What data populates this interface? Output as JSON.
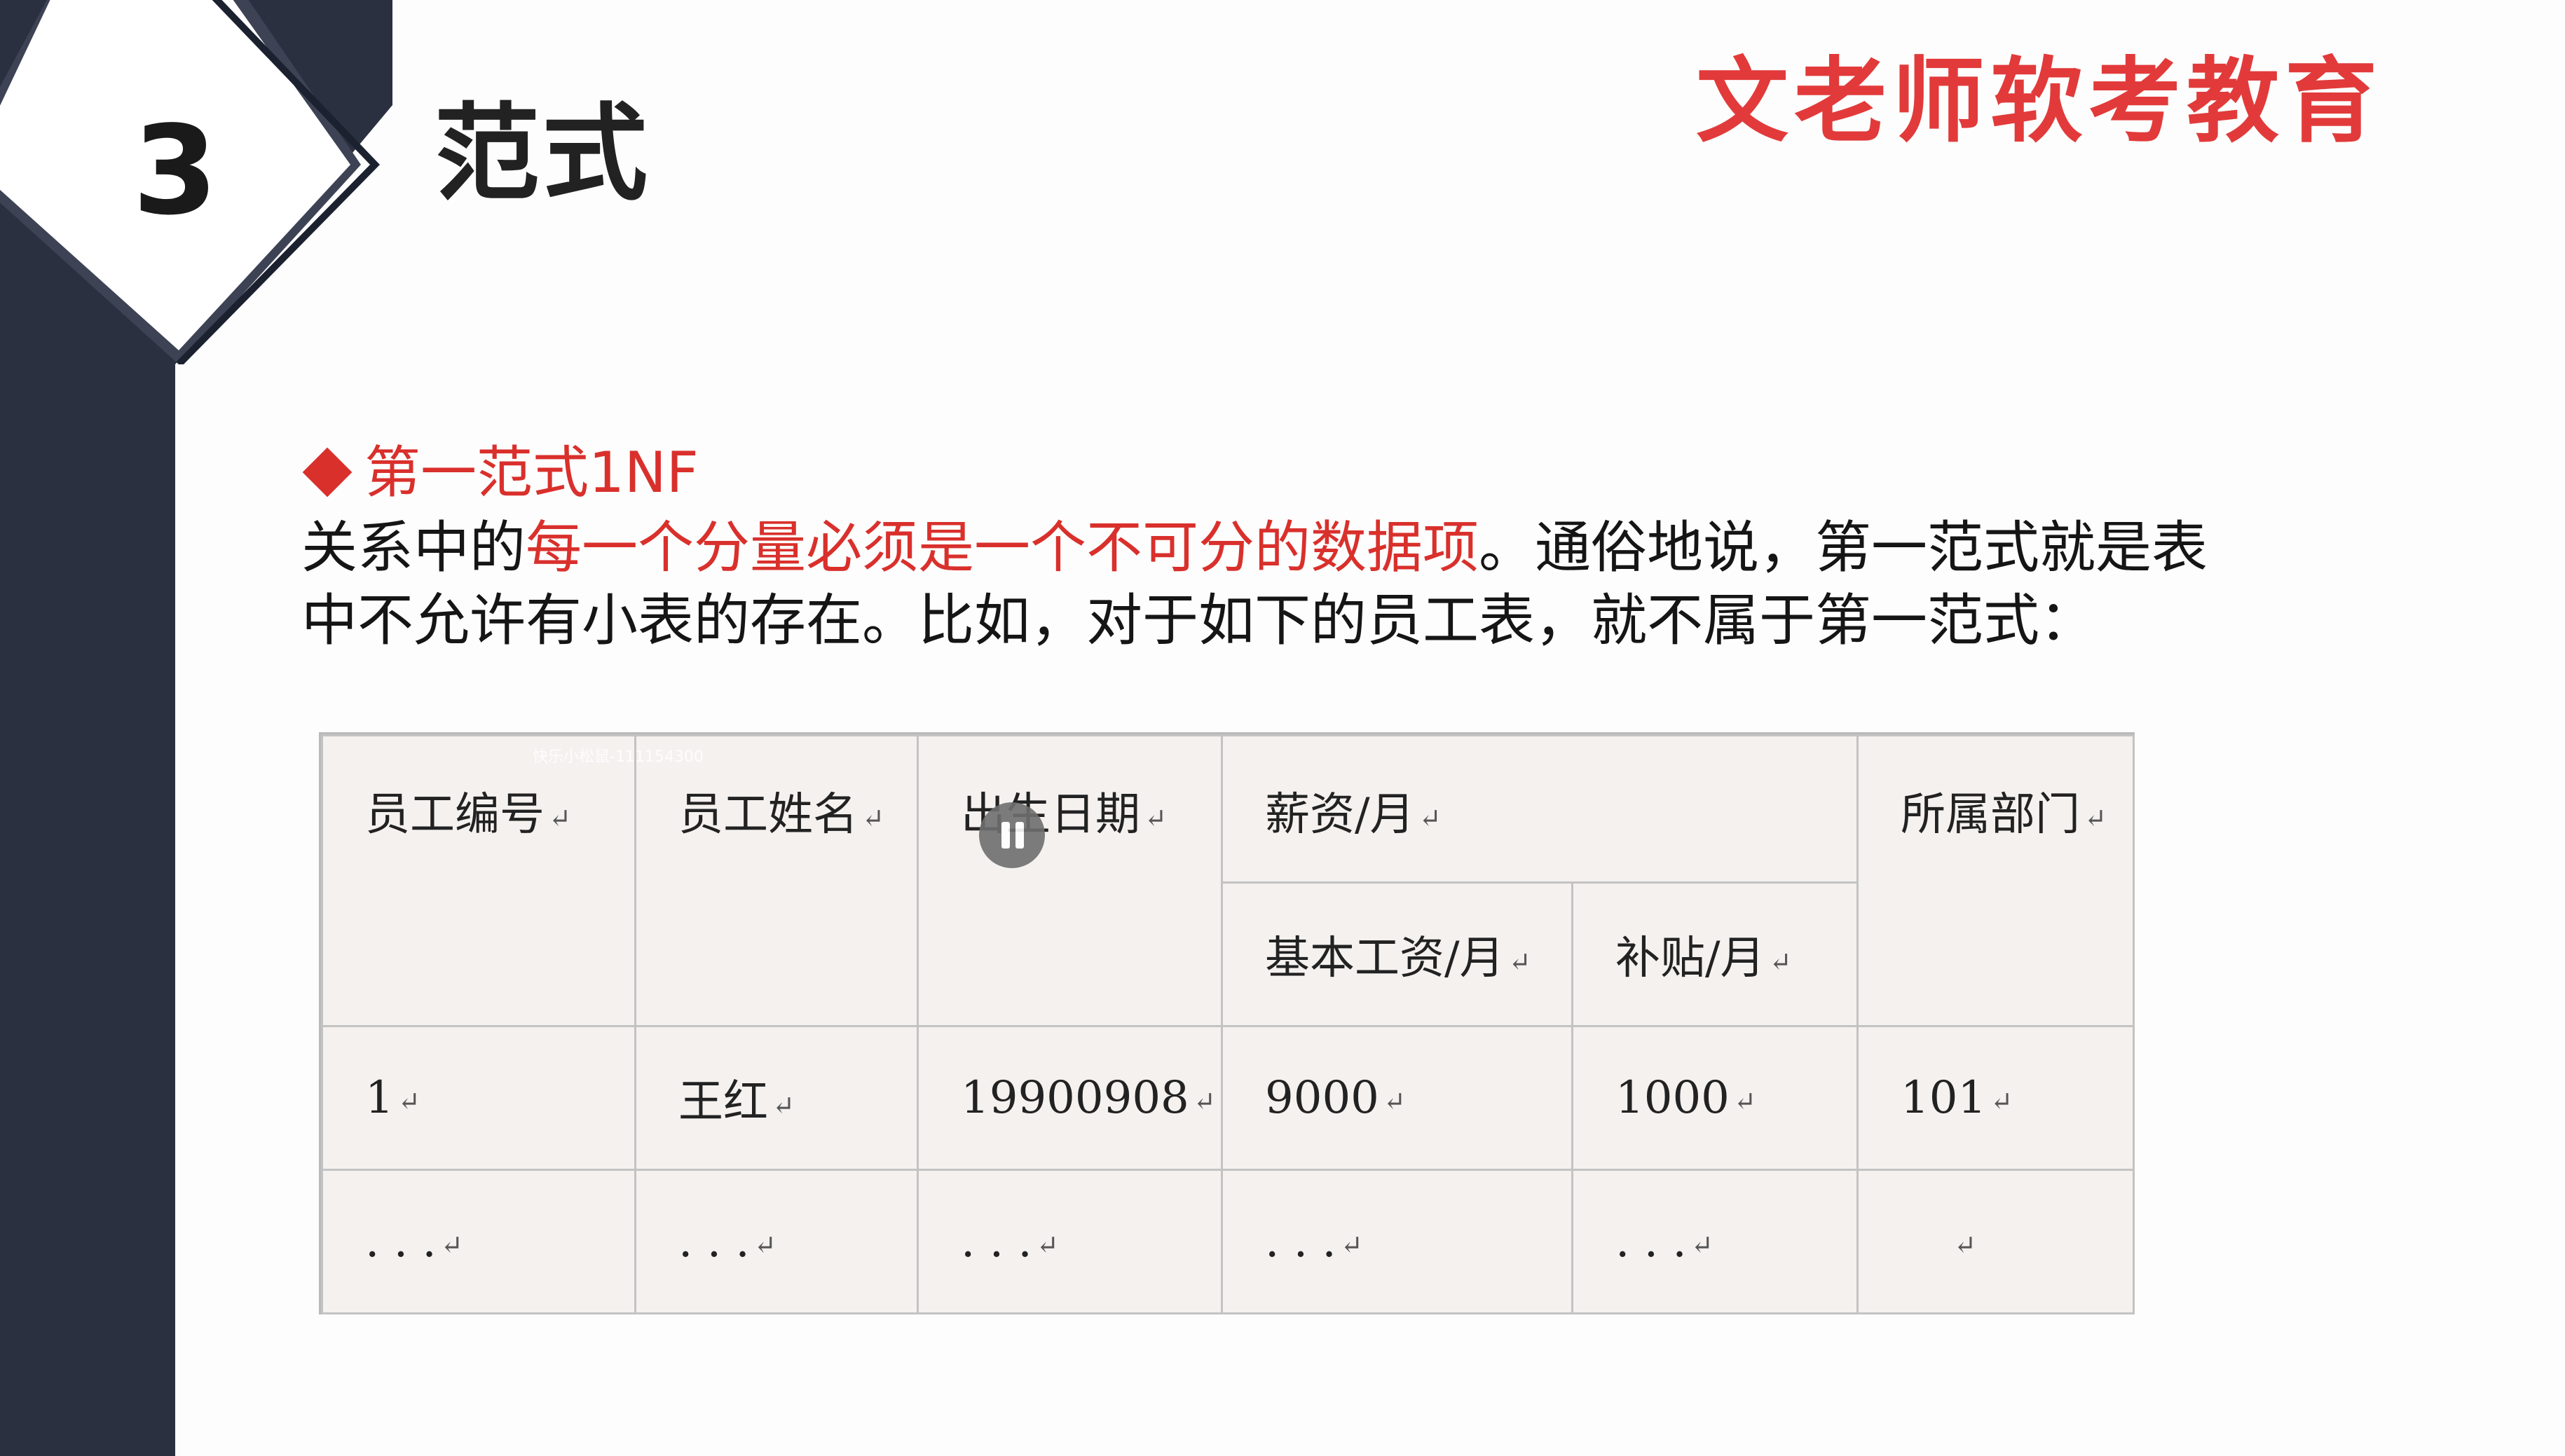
{
  "section": {
    "number": "3",
    "title": "范式"
  },
  "brand": "文老师软考教育",
  "heading": "第一范式1NF",
  "paragraph": {
    "line1_pre": "关系中的",
    "line1_highlight": "每一个分量必须是一个不可分的数据项",
    "line1_post": "。通俗地说，第一范式就是表",
    "line2": "中不允许有小表的存在。比如，对于如下的员工表，就不属于第一范式："
  },
  "table": {
    "headers": {
      "emp_id": "员工编号",
      "emp_name": "员工姓名",
      "birth_date": "出生日期",
      "salary": "薪资/月",
      "base_salary": "基本工资/月",
      "allowance": "补贴/月",
      "department": "所属部门"
    },
    "rows": [
      [
        "1",
        "王红",
        "19900908",
        "9000",
        "1000",
        "101"
      ],
      [
        ". . .",
        ". . .",
        ". . .",
        ". . .",
        ". . .",
        ""
      ]
    ],
    "cell_mark": "↵"
  },
  "overlay": {
    "watermark": "快乐小松鼠-111154300",
    "pause_icon": "pause-icon"
  },
  "colors": {
    "accent_red": "#d9302c",
    "brand_red": "#e23a3a",
    "sidebar": "#2b3040",
    "table_bg": "#f4f1ef"
  }
}
